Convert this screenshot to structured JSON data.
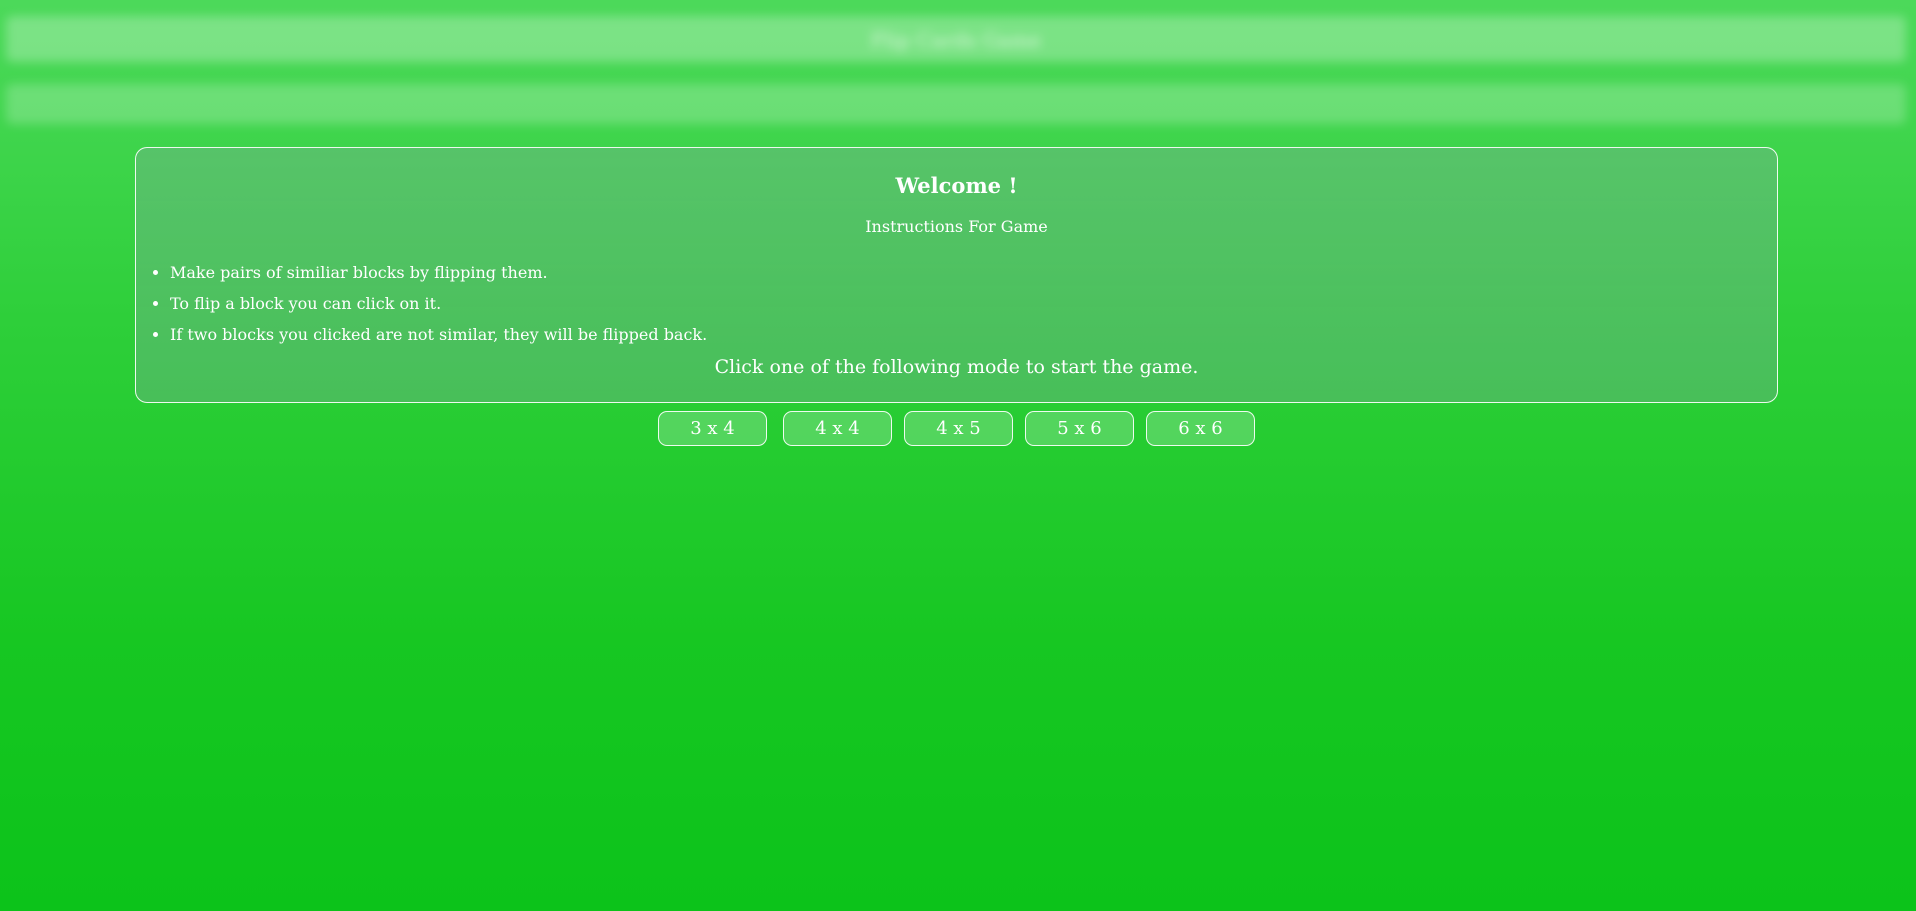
{
  "header": {
    "blurred_title": "Flip Cards Game"
  },
  "welcome": {
    "title": "Welcome !",
    "subtitle": "Instructions For Game",
    "instructions": [
      "Make pairs of similiar blocks by flipping them.",
      "To flip a block you can click on it.",
      "If two blocks you clicked are not similar, they will be flipped back."
    ],
    "call_to_action": "Click one of the following mode to start the game."
  },
  "modes": [
    {
      "label": "3 x 4"
    },
    {
      "label": "4 x 4"
    },
    {
      "label": "4 x 5"
    },
    {
      "label": "5 x 6"
    },
    {
      "label": "6 x 6"
    }
  ],
  "colors": {
    "background_top": "#4cd95a",
    "background_bottom": "#0cc31a",
    "text": "#ffffff"
  }
}
